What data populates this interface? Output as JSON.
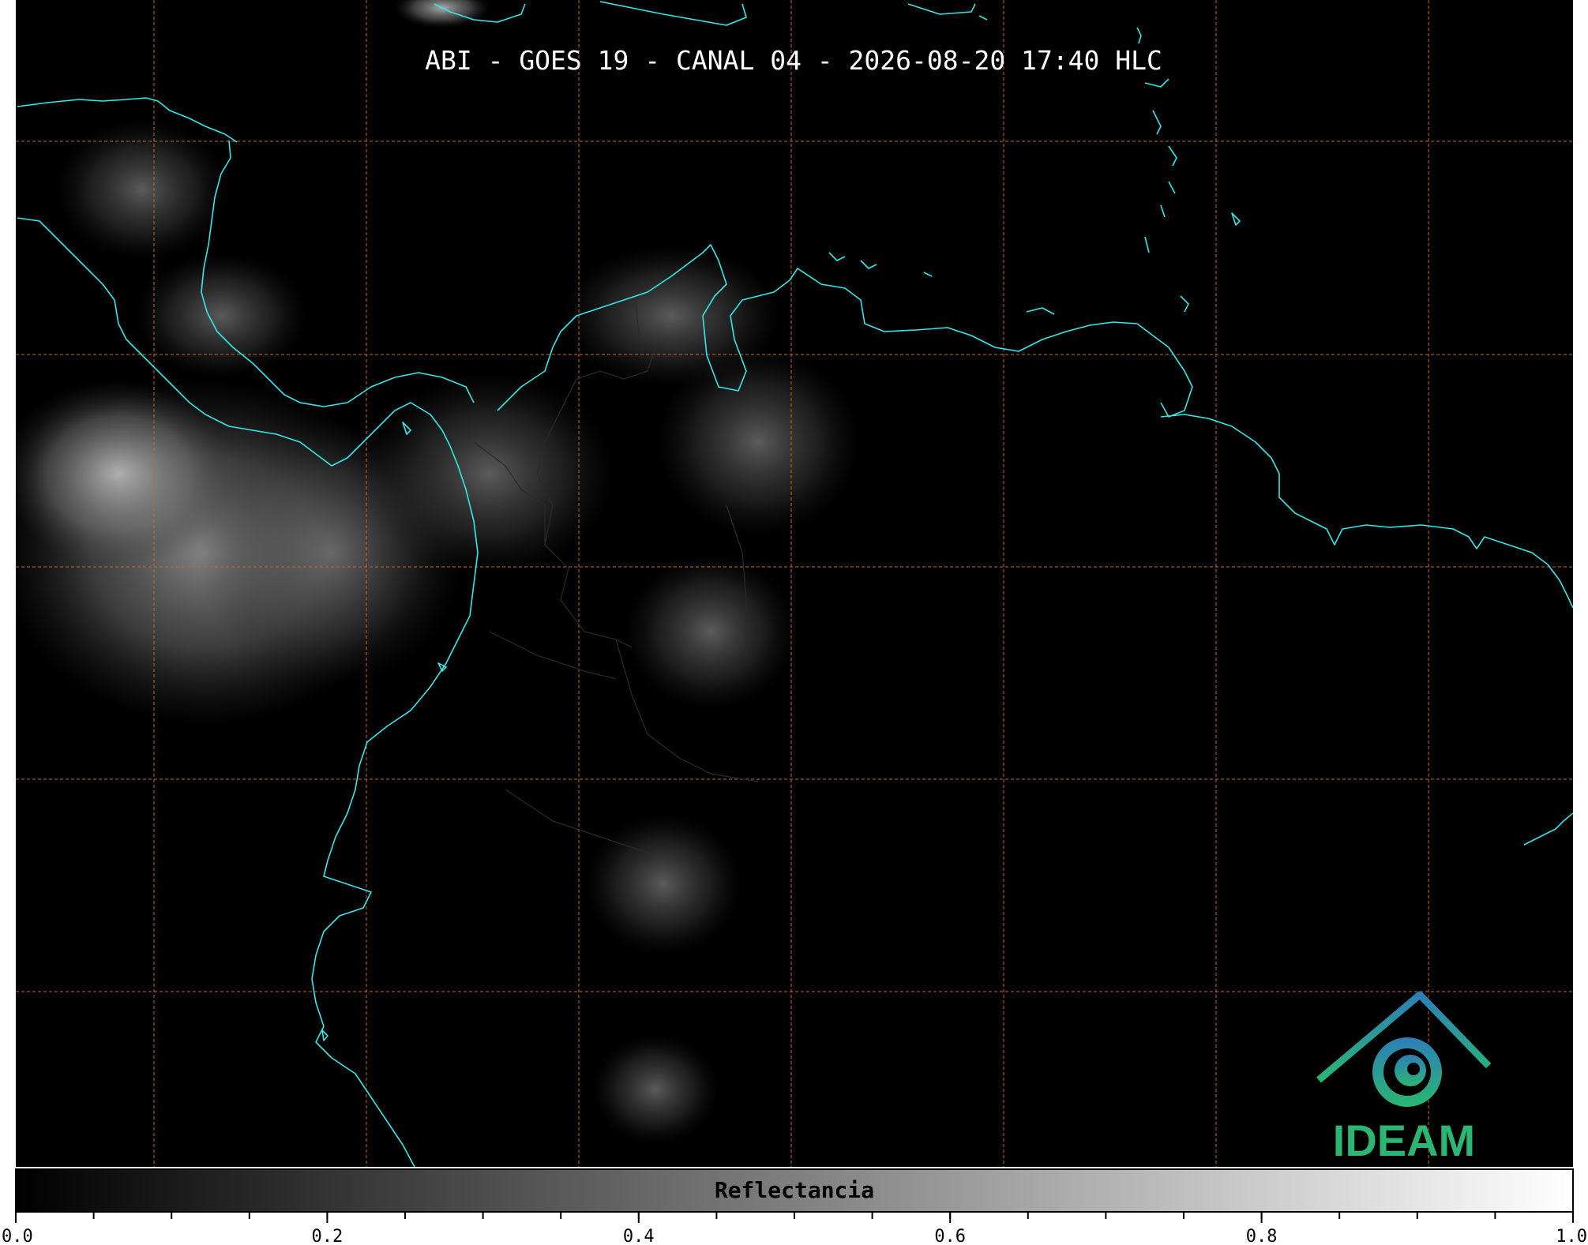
{
  "title": "ABI - GOES 19 - CANAL 04 - 2026-08-20 17:40 HLC",
  "logo_text": "IDEAM",
  "colorbar": {
    "label": "Reflectancia",
    "ticks": [
      "0.0",
      "0.2",
      "0.4",
      "0.6",
      "0.8",
      "1.0"
    ],
    "range": [
      0.0,
      1.0
    ],
    "minor_tick_step": 0.05
  },
  "colors": {
    "background": "#000000",
    "coastline": "#33e8e8",
    "graticule": "#c8662a",
    "title_text": "#ffffff",
    "logo_blue": "#2c7fb8",
    "logo_green": "#2bb673"
  },
  "graticule": {
    "style": "dashed",
    "vertical_lines": 7,
    "horizontal_lines": 5
  }
}
